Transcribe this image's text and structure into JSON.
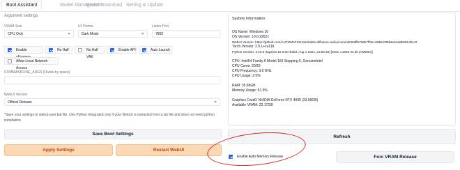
{
  "tabs": [
    {
      "label": "Boot Assistant",
      "active": true
    },
    {
      "label": "Model Management",
      "active": false
    },
    {
      "label": "Model Download",
      "active": false
    },
    {
      "label": "Setting & Update",
      "active": false
    }
  ],
  "argument_settings": {
    "title": "Argument settings",
    "vram": {
      "label": "VRAM Size",
      "value": "CPU Only"
    },
    "theme": {
      "label": "UI Theme",
      "value": "Dark Mode"
    },
    "port": {
      "label": "Listen Port",
      "value": "7860"
    },
    "checkboxes": [
      {
        "label": "Enable xFormers",
        "checked": true
      },
      {
        "label": "No Half",
        "checked": true
      },
      {
        "label": "No Half VAE",
        "checked": false
      },
      {
        "label": "Enable API",
        "checked": true
      },
      {
        "label": "Auto Launch",
        "checked": true
      },
      {
        "label": "Allow Local Network Access",
        "checked": false
      }
    ],
    "commandline_label": "COMMANDLINE_ARGS (Divide by space)",
    "webui_version": {
      "label": "WebUI Version",
      "value": "Official Release"
    },
    "note": "*Save your settings to webui-user.bat file. Use Python integrated only if your WebUI is extracted from a zip file and does not need python installation"
  },
  "system_info": {
    "title": "System Information",
    "lines": [
      "OS Name: Windows 10",
      "OS Version: 10.0.22621",
      "WebUI Version: https://github.com/AUTOMATIC1111/stable-diffusion-webui/commit/39dff5766b7ff3ec484bc00bb6e15a8b581d2cc0",
      "Torch Version: 2.0.1+cu118",
      "Python Version: 3.10.6 (tags/v3.10.6:9c7b4bd, Aug 1 2022, 21:53:49) [MSC v.1932 64 bit (AMD64)]",
      "",
      "CPU: Intel64 Family 6 Model 165 Stepping 5, GenuineIntel",
      "CPU Cores: 20/20",
      "CPU Frequency: 3.6 GHz",
      "CPU Usage: 2.5%",
      "",
      "RAM: 35.86GB",
      "Memory Usage: 51.5%",
      "",
      "Graphics Card0: NVIDIA GeForce RTX 4090 (23.99GB)",
      "Available VRAM: 22.17GB"
    ]
  },
  "buttons": {
    "save_boot": "Save Boot Settings",
    "refresh": "Refresh",
    "apply": "Apply Settings",
    "restart": "Restart WebUI",
    "auto_memory": "Enable Auto Memory Release",
    "force_vram": "Forc VRAM Release"
  },
  "colors": {
    "accent_blue": "#2563eb",
    "orange_bg": "#fbd9b4",
    "orange_text": "#c2410c",
    "annotation_red": "#dc2626"
  }
}
